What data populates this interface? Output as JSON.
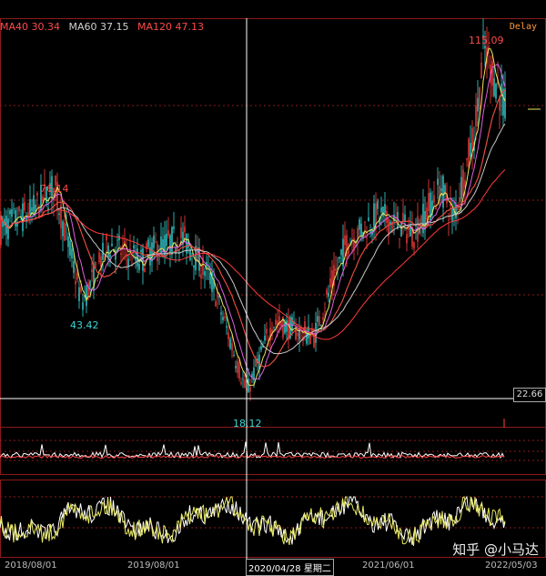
{
  "legend": {
    "ma40": "MA40 30.34",
    "ma60": "MA60 37.15",
    "ma120": "MA120 47.13"
  },
  "status": {
    "delay": "Delay"
  },
  "annotations": {
    "high_all": "115.09",
    "high_2018": "76.14",
    "low_2018": "43.42",
    "low_2020": "18.12"
  },
  "cursor": {
    "price": "22.66",
    "date": "2020/04/28 星期二"
  },
  "x_axis": {
    "dates": [
      "2018/08/01",
      "2019/08/01",
      "2021/06/01",
      "2022/05/03"
    ]
  },
  "watermark": "知乎 @小马达",
  "colors": {
    "ma40": "#ff3b3b",
    "ma60": "#c8c8c8",
    "ma120": "#ff3b3b",
    "grid": "#8b1a1a",
    "up": "#ff4040",
    "down": "#3ad6d6"
  },
  "chart_data": {
    "type": "candlestick",
    "title": "",
    "price_points": [
      [
        "2018/08/01",
        64
      ],
      [
        "2018/10",
        69
      ],
      [
        "2018/11",
        76.14
      ],
      [
        "2019/01",
        43.42
      ],
      [
        "2019/03",
        60
      ],
      [
        "2019/05",
        55
      ],
      [
        "2019/08",
        58
      ],
      [
        "2019/11",
        62
      ],
      [
        "2020/01",
        50
      ],
      [
        "2020/04/28",
        18.12
      ],
      [
        "2020/07",
        38
      ],
      [
        "2020/10",
        34
      ],
      [
        "2021/01",
        60
      ],
      [
        "2021/04",
        68
      ],
      [
        "2021/06",
        63
      ],
      [
        "2021/09",
        76
      ],
      [
        "2021/12",
        67
      ],
      [
        "2022/02",
        92
      ],
      [
        "2022/03",
        115.09
      ],
      [
        "2022/05/03",
        98
      ]
    ],
    "ma_values": {
      "MA40": 30.34,
      "MA60": 37.15,
      "MA120": 47.13
    }
  }
}
